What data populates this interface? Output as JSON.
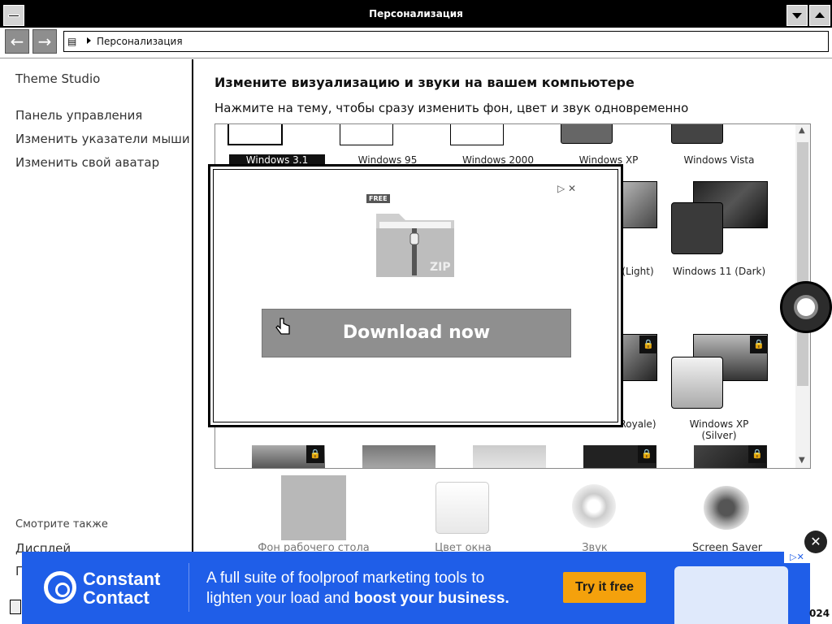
{
  "window": {
    "title": "Персонализация"
  },
  "address": {
    "breadcrumb": "Персонализация"
  },
  "sidebar": {
    "items": [
      {
        "label": "Theme Studio"
      },
      {
        "label": "Панель управления"
      },
      {
        "label": "Изменить указатели мыши"
      },
      {
        "label": "Изменить свой аватар"
      }
    ],
    "see_also_title": "Смотрите также",
    "see_also_items": [
      {
        "label": "Дисплей"
      },
      {
        "label": "П"
      }
    ]
  },
  "main": {
    "heading": "Измените визуализацию и звуки на вашем компьютере",
    "subheading": "Нажмите на тему, чтобы сразу изменить фон, цвет и звук одновременно",
    "themes_row1": [
      "Windows 3.1",
      "Windows 95",
      "Windows 2000",
      "Windows XP",
      "Windows Vista"
    ],
    "themes_row2_visible": [
      "(Light)",
      "Windows 11 (Dark)"
    ],
    "themes_row3_visible": [
      "Royale)",
      "Windows XP (Silver)"
    ],
    "bottom_items": [
      "Фон рабочего стола",
      "Цвет окна",
      "Звук",
      "Screen Saver"
    ]
  },
  "ad_popup": {
    "free_badge": "FREE",
    "zip_label": "ZIP",
    "download_button": "Download now"
  },
  "banner": {
    "brand_line1": "Constant",
    "brand_line2": "Contact",
    "tagline_part1": "A full suite of foolproof marketing tools to",
    "tagline_part2": "lighten your load and ",
    "tagline_bold": "boost your business.",
    "cta": "Try it free"
  },
  "edge": {
    "year_fragment": "024"
  },
  "colors": {
    "banner_bg": "#1f5ee8",
    "cta_bg": "#f4a10c"
  }
}
